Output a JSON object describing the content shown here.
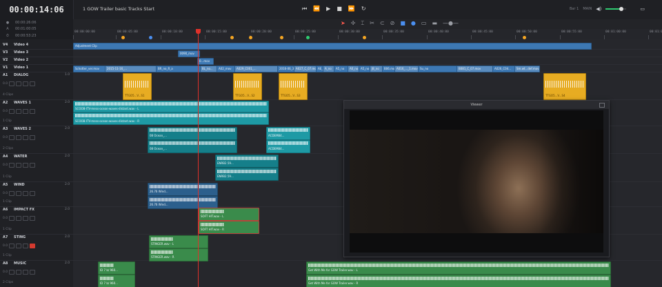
{
  "header": {
    "timecode": "00:00:14:06",
    "timeline_name": "1 GOW Trailer basic Tracks Start",
    "top_right": {
      "left_label": "Bar 1",
      "right_label": "MAIN"
    }
  },
  "timecodes": [
    {
      "label": "●",
      "value": "00:00:26:06"
    },
    {
      "label": "A",
      "value": "00:01:00:05"
    },
    {
      "label": "⏱",
      "value": "00:00:53:23"
    }
  ],
  "ruler": {
    "ticks": [
      "00:00:00:00",
      "00:00:05:00",
      "00:00:10:00",
      "00:00:15:00",
      "00:00:20:00",
      "00:00:25:00",
      "00:00:30:00",
      "00:00:35:00",
      "00:00:40:00",
      "00:00:45:00",
      "00:00:50:00",
      "00:00:55:00",
      "00:01:00:00",
      "00:01:05:00"
    ],
    "marker_colors": [
      "#f5a623",
      "#4b8ff0",
      "#f5a623",
      "#f5a623",
      "#f5a623",
      "#2ecc71",
      "#f5a623",
      "#f5a623"
    ]
  },
  "tracks": [
    {
      "id": "V4",
      "name": "Video 4"
    },
    {
      "id": "V3",
      "name": "Video 3"
    },
    {
      "id": "V2",
      "name": "Video 2"
    },
    {
      "id": "V1",
      "name": "Video 1"
    },
    {
      "id": "A1",
      "name": "DIALOG",
      "vol": "1.0",
      "clips": "4 Clips",
      "level": "0.0"
    },
    {
      "id": "A2",
      "name": "WAVES 1",
      "vol": "2.0",
      "clips": "1 Clip",
      "level": "0.0"
    },
    {
      "id": "A3",
      "name": "WAVES 2",
      "vol": "2.0",
      "clips": "2 Clips",
      "level": "0.0"
    },
    {
      "id": "A4",
      "name": "WATER",
      "vol": "2.0",
      "clips": "1 Clip",
      "level": "0.0"
    },
    {
      "id": "A5",
      "name": "WIND",
      "vol": "2.0",
      "clips": "1 Clip",
      "level": "0.0"
    },
    {
      "id": "A6",
      "name": "IMPACT FX",
      "vol": "2.0",
      "clips": "1 Clip",
      "level": "0.0"
    },
    {
      "id": "A7",
      "name": "STING",
      "vol": "2.0",
      "clips": "1 Clip",
      "level": "0.0"
    },
    {
      "id": "A8",
      "name": "MUSIC",
      "vol": "2.0",
      "clips": "2 Clips",
      "level": "0.0"
    }
  ],
  "clip_labels": {
    "adjustment": "Adjustment Clip",
    "v3": "0090_mov",
    "v2": "0...mov",
    "v1": [
      "Schotter_ver.mov",
      "2015-11-16_...",
      "BR_no_R_a",
      "BL_no...",
      "A02_mov",
      "A029_C001_...",
      "2016-06_301.mov",
      "A027_C_07.mov",
      "AE_no",
      "A_no",
      "A5_no",
      "A0_no",
      "A5_no",
      "J8_no",
      "B06.mov",
      "A016_..._1.mov",
      "Su_no",
      "B081_C_07.mov",
      "A026_C04...",
      "Sm.wt...def.mov"
    ],
    "dialog": [
      "TTGO5...V...S1",
      "TTGO5...V...S2",
      "TTGO5...V...S3",
      "TTGO5...V...S4"
    ],
    "waves1": [
      "SCOOB-ITV-mess-ocean-waves-distant.wav - L",
      "SCOOB-ITV-mess-ocean-waves-distant.wav - R"
    ],
    "waves2": [
      "08 Ocean_...",
      "08 Ocean_...",
      "ACDEM84...",
      "ACDEM84..."
    ],
    "water": [
      "ENRB2.59...",
      "ENRB2.59..."
    ],
    "wind": [
      "26.76 Wind...",
      "26.76 Wind..."
    ],
    "impact": [
      "SOFT HIT.wav - L",
      "SOFT HIT.wav - R"
    ],
    "sting": [
      "STINGER.wav - L",
      "STINGER.wav - R"
    ],
    "music": [
      "ID 7 b/ 960...",
      "ID 7 b/ 960...",
      "Get With Me for GOW Trailer.wav - L",
      "Get With Me for GOW Trailer.wav - R"
    ]
  },
  "viewer": {
    "title": "Viewer"
  },
  "colors": {
    "video": "#3d78b3",
    "dialog": "#e7ac22",
    "cyan": "#1e9aa5",
    "green": "#3a8b4b",
    "playhead": "#e0312a"
  }
}
